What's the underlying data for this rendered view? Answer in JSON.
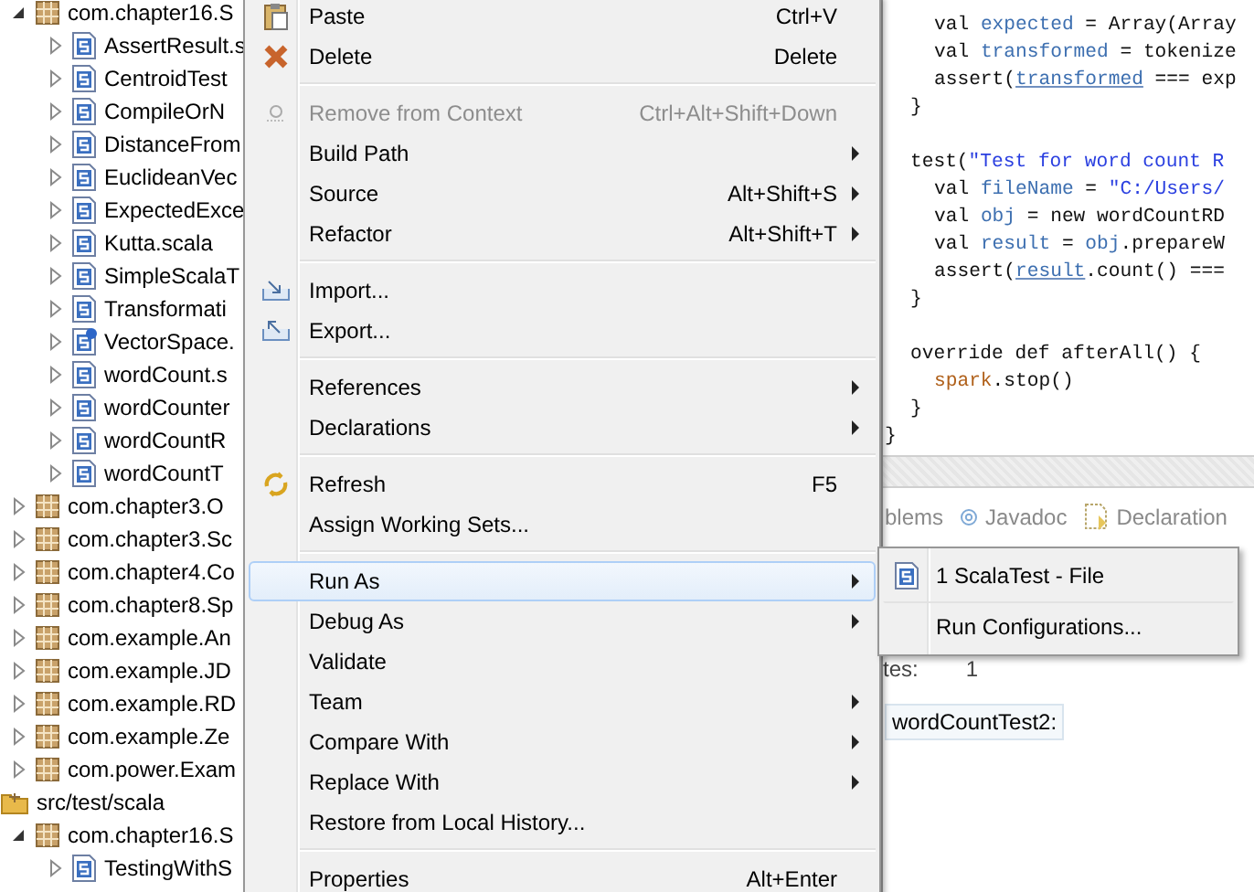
{
  "tree": {
    "items": [
      {
        "label": "com.chapter16.S",
        "kind": "package",
        "expanded": true,
        "children": [
          {
            "label": "AssertResult.s",
            "kind": "scala-file",
            "expanded": false
          },
          {
            "label": "CentroidTest",
            "kind": "scala-file",
            "expanded": false
          },
          {
            "label": "CompileOrN",
            "kind": "scala-file",
            "expanded": false
          },
          {
            "label": "DistanceFrom",
            "kind": "scala-file",
            "expanded": false
          },
          {
            "label": "EuclideanVec",
            "kind": "scala-file",
            "expanded": false
          },
          {
            "label": "ExpectedExce",
            "kind": "scala-file",
            "expanded": false
          },
          {
            "label": "Kutta.scala",
            "kind": "scala-file",
            "expanded": false
          },
          {
            "label": "SimpleScalaT",
            "kind": "scala-file",
            "expanded": false
          },
          {
            "label": "Transformati",
            "kind": "scala-file",
            "expanded": false
          },
          {
            "label": "VectorSpace.",
            "kind": "scala-file-info",
            "expanded": false
          },
          {
            "label": "wordCount.s",
            "kind": "scala-file",
            "expanded": false
          },
          {
            "label": "wordCounter",
            "kind": "scala-file",
            "expanded": false
          },
          {
            "label": "wordCountR",
            "kind": "scala-file",
            "expanded": false
          },
          {
            "label": "wordCountT",
            "kind": "scala-file",
            "expanded": false
          }
        ]
      },
      {
        "label": "com.chapter3.O",
        "kind": "package",
        "expanded": false
      },
      {
        "label": "com.chapter3.Sc",
        "kind": "package",
        "expanded": false
      },
      {
        "label": "com.chapter4.Co",
        "kind": "package",
        "expanded": false
      },
      {
        "label": "com.chapter8.Sp",
        "kind": "package",
        "expanded": false
      },
      {
        "label": "com.example.An",
        "kind": "package",
        "expanded": false
      },
      {
        "label": "com.example.JD",
        "kind": "package",
        "expanded": false
      },
      {
        "label": "com.example.RD",
        "kind": "package",
        "expanded": false
      },
      {
        "label": "com.example.Ze",
        "kind": "package",
        "expanded": false
      },
      {
        "label": "com.power.Exam",
        "kind": "package",
        "expanded": false
      },
      {
        "label": "src/test/scala",
        "kind": "folder",
        "expanded": true,
        "children": [
          {
            "label": "com.chapter16.S",
            "kind": "package",
            "expanded": true,
            "children": [
              {
                "label": "TestingWithS",
                "kind": "scala-file",
                "expanded": false
              }
            ]
          }
        ]
      }
    ]
  },
  "editor": {
    "lines": [
      {
        "kind": "indented",
        "tokens": [
          {
            "text": "val ",
            "kind": "plain"
          },
          {
            "text": "expected",
            "kind": "var"
          },
          {
            "text": " = Array(Array",
            "kind": "plain"
          }
        ]
      },
      {
        "kind": "indented",
        "tokens": [
          {
            "text": "val ",
            "kind": "plain"
          },
          {
            "text": "transformed",
            "kind": "var"
          },
          {
            "text": " = tokenize",
            "kind": "plain"
          }
        ]
      },
      {
        "kind": "indented",
        "tokens": [
          {
            "text": "assert(",
            "kind": "plain"
          },
          {
            "text": "transformed",
            "kind": "ref"
          },
          {
            "text": " === exp",
            "kind": "plain"
          }
        ]
      },
      {
        "kind": "body",
        "tokens": [
          {
            "text": "}",
            "kind": "plain"
          }
        ]
      },
      {
        "kind": "blank"
      },
      {
        "kind": "body",
        "tokens": [
          {
            "text": "test(",
            "kind": "plain"
          },
          {
            "text": "\"Test for word count R",
            "kind": "string"
          }
        ]
      },
      {
        "kind": "indented",
        "tokens": [
          {
            "text": "val ",
            "kind": "plain"
          },
          {
            "text": "fileName",
            "kind": "var"
          },
          {
            "text": " = ",
            "kind": "plain"
          },
          {
            "text": "\"C:/Users/",
            "kind": "string"
          }
        ]
      },
      {
        "kind": "indented",
        "tokens": [
          {
            "text": "val ",
            "kind": "plain"
          },
          {
            "text": "obj",
            "kind": "var"
          },
          {
            "text": " = new wordCountRD",
            "kind": "plain"
          }
        ]
      },
      {
        "kind": "indented",
        "tokens": [
          {
            "text": "val ",
            "kind": "plain"
          },
          {
            "text": "result",
            "kind": "var"
          },
          {
            "text": " = ",
            "kind": "plain"
          },
          {
            "text": "obj",
            "kind": "var"
          },
          {
            "text": ".prepareW",
            "kind": "plain"
          }
        ]
      },
      {
        "kind": "indented",
        "tokens": [
          {
            "text": "assert(",
            "kind": "plain"
          },
          {
            "text": "result",
            "kind": "ref"
          },
          {
            "text": ".count() ===",
            "kind": "plain"
          }
        ]
      },
      {
        "kind": "body",
        "tokens": [
          {
            "text": "}",
            "kind": "plain"
          }
        ]
      },
      {
        "kind": "blank"
      },
      {
        "kind": "body",
        "tokens": [
          {
            "text": "override def afterAll() {",
            "kind": "plain"
          }
        ]
      },
      {
        "kind": "indented",
        "tokens": [
          {
            "text": "spark",
            "kind": "object"
          },
          {
            "text": ".stop()",
            "kind": "plain"
          }
        ]
      },
      {
        "kind": "body",
        "tokens": [
          {
            "text": "}",
            "kind": "plain"
          }
        ]
      },
      {
        "kind": "outer",
        "tokens": [
          {
            "text": "}",
            "kind": "plain"
          }
        ]
      }
    ]
  },
  "bottom_panel": {
    "tabs": [
      {
        "label": "blems",
        "kind": "plain"
      },
      {
        "label": "Javadoc",
        "kind": "javadoc"
      },
      {
        "label": "Declaration",
        "kind": "declaration"
      }
    ],
    "summary_label": "tes:",
    "summary_value": "1",
    "result_item": "wordCountTest2:"
  },
  "context_menu": {
    "items": [
      {
        "kind": "paste",
        "label": "Paste",
        "shortcut": "Ctrl+V",
        "submenu": false,
        "disabled": false,
        "selected": false
      },
      {
        "kind": "delete",
        "label": "Delete",
        "shortcut": "Delete",
        "submenu": false,
        "disabled": false,
        "selected": false
      },
      {
        "kind": "separator"
      },
      {
        "kind": "remove",
        "label": "Remove from Context",
        "shortcut": "Ctrl+Alt+Shift+Down",
        "submenu": false,
        "disabled": true,
        "selected": false
      },
      {
        "kind": "plain",
        "label": "Build Path",
        "submenu": true,
        "disabled": false,
        "selected": false
      },
      {
        "kind": "plain",
        "label": "Source",
        "shortcut": "Alt+Shift+S",
        "submenu": true,
        "disabled": false,
        "selected": false
      },
      {
        "kind": "plain",
        "label": "Refactor",
        "shortcut": "Alt+Shift+T",
        "submenu": true,
        "disabled": false,
        "selected": false
      },
      {
        "kind": "separator"
      },
      {
        "kind": "import",
        "label": "Import...",
        "submenu": false,
        "disabled": false,
        "selected": false
      },
      {
        "kind": "export",
        "label": "Export...",
        "submenu": false,
        "disabled": false,
        "selected": false
      },
      {
        "kind": "separator"
      },
      {
        "kind": "plain",
        "label": "References",
        "submenu": true,
        "disabled": false,
        "selected": false
      },
      {
        "kind": "plain",
        "label": "Declarations",
        "submenu": true,
        "disabled": false,
        "selected": false
      },
      {
        "kind": "separator"
      },
      {
        "kind": "refresh",
        "label": "Refresh",
        "shortcut": "F5",
        "submenu": false,
        "disabled": false,
        "selected": false
      },
      {
        "kind": "plain",
        "label": "Assign Working Sets...",
        "submenu": false,
        "disabled": false,
        "selected": false
      },
      {
        "kind": "separator"
      },
      {
        "kind": "plain",
        "label": "Run As",
        "submenu": true,
        "disabled": false,
        "selected": true
      },
      {
        "kind": "plain",
        "label": "Debug As",
        "submenu": true,
        "disabled": false,
        "selected": false
      },
      {
        "kind": "plain",
        "label": "Validate",
        "submenu": false,
        "disabled": false,
        "selected": false
      },
      {
        "kind": "plain",
        "label": "Team",
        "submenu": true,
        "disabled": false,
        "selected": false
      },
      {
        "kind": "plain",
        "label": "Compare With",
        "submenu": true,
        "disabled": false,
        "selected": false
      },
      {
        "kind": "plain",
        "label": "Replace With",
        "submenu": true,
        "disabled": false,
        "selected": false
      },
      {
        "kind": "plain",
        "label": "Restore from Local History...",
        "submenu": false,
        "disabled": false,
        "selected": false
      },
      {
        "kind": "separator"
      },
      {
        "kind": "plain",
        "label": "Properties",
        "shortcut": "Alt+Enter",
        "submenu": false,
        "disabled": false,
        "selected": false
      }
    ]
  },
  "submenu": {
    "items": [
      {
        "kind": "scala-file",
        "label": "1 ScalaTest - File",
        "selected": false
      },
      {
        "kind": "plain",
        "label": "Run Configurations...",
        "selected": false
      }
    ]
  }
}
